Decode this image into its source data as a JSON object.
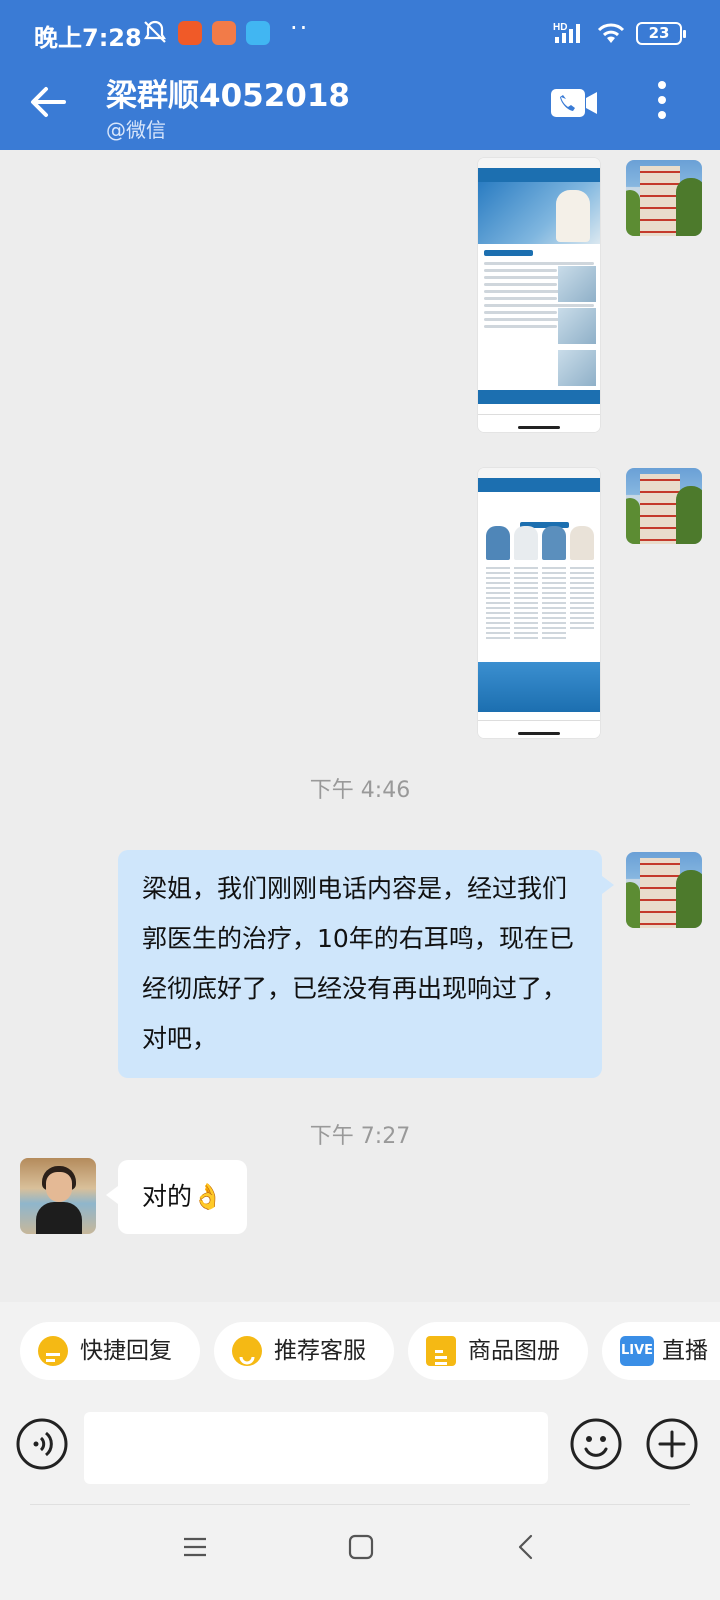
{
  "status_bar": {
    "time": "晚上7:28",
    "battery": "23",
    "signal_label": "HD",
    "more_dots": "··"
  },
  "header": {
    "title": "梁群顺4052018",
    "subtitle": "@微信"
  },
  "messages": {
    "timestamp_1": "下午 4:46",
    "sent_text": "梁姐，我们刚刚电话内容是，经过我们郭医生的治疗，10年的右耳鸣，现在已经彻底好了，已经没有再出现响过了，对吧，",
    "timestamp_2": "下午 7:27",
    "reply_text": "对的👌"
  },
  "quick_replies": [
    {
      "label": "快捷回复",
      "icon": "quick-reply-icon",
      "color": "#f5b914"
    },
    {
      "label": "推荐客服",
      "icon": "service-icon",
      "color": "#f5b914"
    },
    {
      "label": "商品图册",
      "icon": "catalog-icon",
      "color": "#f5b914"
    },
    {
      "label": "直播",
      "icon": "live-icon",
      "color": "#3a8ee6",
      "badge": "LIVE"
    }
  ],
  "colors": {
    "header_blue": "#3a7bd5",
    "sent_bubble": "#cfe6fb",
    "background": "#ededed"
  }
}
